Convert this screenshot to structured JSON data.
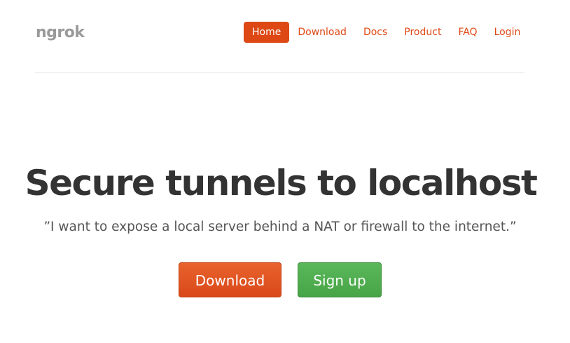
{
  "brand": {
    "name": "ngrok"
  },
  "nav": {
    "items": [
      {
        "label": "Home",
        "active": true
      },
      {
        "label": "Download",
        "active": false
      },
      {
        "label": "Docs",
        "active": false
      },
      {
        "label": "Product",
        "active": false
      },
      {
        "label": "FAQ",
        "active": false
      },
      {
        "label": "Login",
        "active": false
      }
    ]
  },
  "hero": {
    "headline": "Secure tunnels to localhost",
    "tagline": "”I want to expose a local server behind a NAT or firewall to the internet.”",
    "download_label": "Download",
    "signup_label": "Sign up"
  },
  "colors": {
    "accent": "#dd4814",
    "success": "#47a447",
    "brand_gray": "#9a9a9a",
    "headline": "#333333"
  }
}
